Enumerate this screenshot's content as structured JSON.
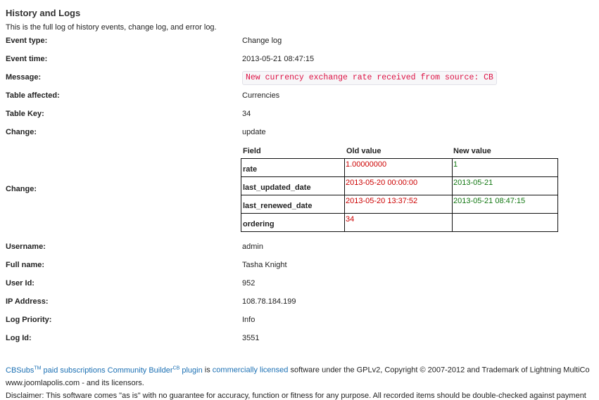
{
  "header": {
    "title": "History and Logs",
    "subtitle": "This is the full log of history events, change log, and error log."
  },
  "fields": {
    "event_type": {
      "label": "Event type:",
      "value": "Change log"
    },
    "event_time": {
      "label": "Event time:",
      "value": "2013-05-21 08:47:15"
    },
    "message": {
      "label": "Message:",
      "value": "New currency exchange rate received from source: CB"
    },
    "table_affected": {
      "label": "Table affected:",
      "value": "Currencies"
    },
    "table_key": {
      "label": "Table Key:",
      "value": "34"
    },
    "change": {
      "label": "Change:",
      "value": "update"
    },
    "change_detail": {
      "label": "Change:"
    },
    "username": {
      "label": "Username:",
      "value": "admin"
    },
    "full_name": {
      "label": "Full name:",
      "value": "Tasha Knight"
    },
    "user_id": {
      "label": "User Id:",
      "value": "952"
    },
    "ip_address": {
      "label": "IP Address:",
      "value": "108.78.184.199"
    },
    "log_priority": {
      "label": "Log Priority:",
      "value": "Info"
    },
    "log_id": {
      "label": "Log Id:",
      "value": "3551"
    }
  },
  "changes": {
    "headers": {
      "field": "Field",
      "old": "Old value",
      "new": "New value"
    },
    "rows": [
      {
        "field": "rate",
        "old": "1.00000000",
        "new": "1"
      },
      {
        "field": "last_updated_date",
        "old": "2013-05-20 00:00:00",
        "new": "2013-05-21"
      },
      {
        "field": "last_renewed_date",
        "old": "2013-05-20 13:37:52",
        "new": "2013-05-21 08:47:15"
      },
      {
        "field": "ordering",
        "old": "34",
        "new": ""
      }
    ],
    "old_color": "#cc0000",
    "new_color": "#117711"
  },
  "footer": {
    "cbsubs": "CBSubs",
    "tm": "TM",
    "paid_link": "paid subscriptions Community Builder",
    "cb_sup": "CB",
    "plugin_link": "plugin",
    "is_text": "is",
    "licensed_link": "commercially licensed",
    "rest": "software under the GPLv2, Copyright © 2007-2012 and Trademark of Lightning MultiCo",
    "line2": "www.joomlapolis.com - and its licensors.",
    "line3": "Disclaimer: This software comes \"as is\" with no guarantee for accuracy, function or fitness for any purpose. All recorded items should be double-checked against payment"
  },
  "colors": {
    "link": "#1a6fb3",
    "message_text": "#dd1144"
  }
}
